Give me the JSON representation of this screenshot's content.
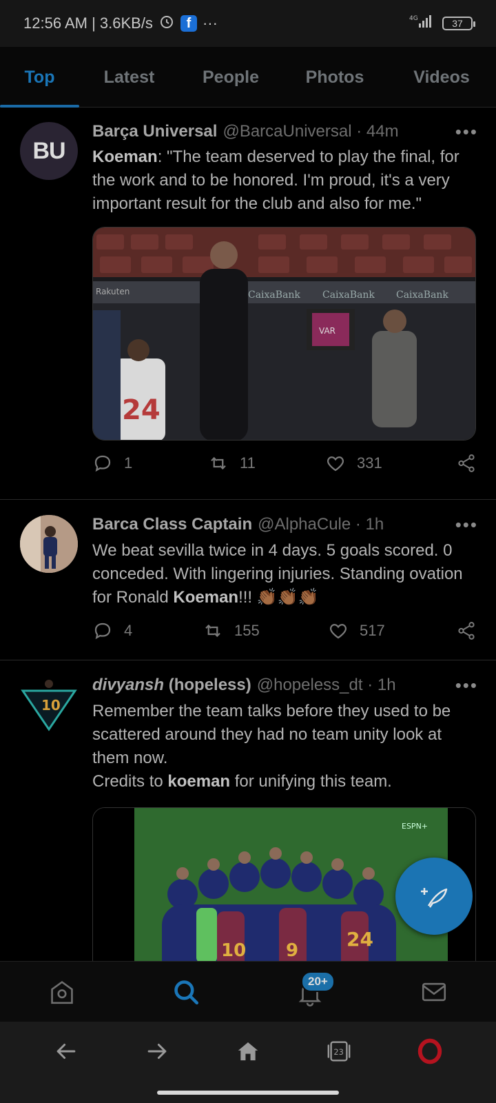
{
  "status_bar": {
    "time_speed": "12:56 AM | 3.6KB/s",
    "app_badge": "f",
    "more": "···",
    "network": "4G",
    "battery": "37"
  },
  "tabs": [
    {
      "label": "Top",
      "active": true
    },
    {
      "label": "Latest",
      "active": false
    },
    {
      "label": "People",
      "active": false
    },
    {
      "label": "Photos",
      "active": false
    },
    {
      "label": "Videos",
      "active": false
    }
  ],
  "tweets": [
    {
      "avatar_text": "BU",
      "name": "Barça Universal",
      "handle": "@BarcaUniversal · 44m",
      "text_bold": "Koeman",
      "text": ": \"The team deserved to play the final, for the work and to be honored. I'm proud, it's a very important result for the club and also for me.\"",
      "media_labels": [
        "Rakuten",
        "CaixaBank",
        "CaixaBank",
        "CaixaBank",
        "VAR",
        "24"
      ],
      "replies": "1",
      "retweets": "11",
      "likes": "331"
    },
    {
      "name": "Barca Class Captain",
      "handle": "@AlphaCule · 1h",
      "text_pre": "We beat sevilla twice in 4 days. 5 goals scored. 0 conceded. With lingering injuries. Standing ovation for Ronald ",
      "text_bold": "Koeman",
      "text_post": "!!! 👏🏾👏🏾👏🏾",
      "replies": "4",
      "retweets": "155",
      "likes": "517"
    },
    {
      "avatar_text": "10",
      "name_italic": "divyansh",
      "name_rest": " (hopeless)",
      "handle": "@hopeless_dt · 1h",
      "text_line1": "Remember the team talks before they used to be scattered around they had no team unity look at them now.",
      "text_pre": "Credits to ",
      "text_bold": "koeman",
      "text_post": " for unifying this team.",
      "media_labels": [
        "ESPN+",
        "24",
        "10",
        "9"
      ]
    }
  ],
  "bottom_nav": {
    "notifications_badge": "20+"
  },
  "browser_bar": {
    "tabs_count": "23"
  },
  "colors": {
    "accent": "#1a76b8",
    "background": "#000000",
    "fab": "#1b74b3"
  }
}
